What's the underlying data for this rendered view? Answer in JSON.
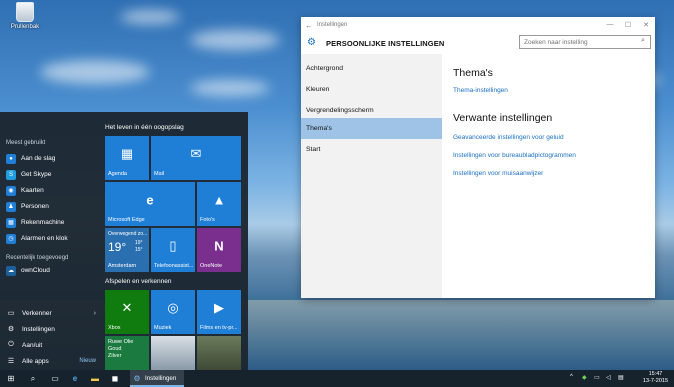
{
  "desktop": {
    "recycle_bin_label": "Prullenbak"
  },
  "start_menu": {
    "most_used_heading": "Meest gebruikt",
    "most_used": [
      {
        "label": "Aan de slag",
        "icon": "lightbulb-icon",
        "color": "#1f7ed6"
      },
      {
        "label": "Get Skype",
        "icon": "skype-icon",
        "color": "#1f9fe0"
      },
      {
        "label": "Kaarten",
        "icon": "maps-icon",
        "color": "#1f7ed6"
      },
      {
        "label": "Personen",
        "icon": "people-icon",
        "color": "#1f7ed6"
      },
      {
        "label": "Rekenmachine",
        "icon": "calculator-icon",
        "color": "#1f7ed6"
      },
      {
        "label": "Alarmen en klok",
        "icon": "alarm-clock-icon",
        "color": "#1f7ed6"
      }
    ],
    "recent_heading": "Recentelijk toegevoegd",
    "recent": [
      {
        "label": "ownCloud",
        "icon": "owncloud-icon",
        "color": "#1d5f9b"
      }
    ],
    "system": {
      "explorer": "Verkenner",
      "settings": "Instellingen",
      "power": "Aan/uit",
      "all_apps": "Alle apps",
      "new_badge": "Nieuw"
    },
    "life_heading": "Het leven in één oogopslag",
    "play_heading": "Afspelen en verkennen",
    "tiles": {
      "agenda": "Agenda",
      "mail": "Mail",
      "edge": "Microsoft Edge",
      "photos": "Foto's",
      "weather_top": "Overwegend zo...",
      "weather_temp": "19°",
      "weather_hi": "19°",
      "weather_lo": "15°",
      "weather_city": "Amsterdam",
      "phone": "Telefoonassist...",
      "onenote": "OneNote",
      "xbox": "Xbox",
      "music": "Muziek",
      "films": "Films en tv-pr...",
      "money_1": "Ruwe Olie",
      "money_2": "Goud",
      "money_3": "Zilver"
    }
  },
  "settings": {
    "window_title": "Instellingen",
    "header_title": "PERSOONLIJKE INSTELLINGEN",
    "search_placeholder": "Zoeken naar instelling",
    "nav": [
      "Achtergrond",
      "Kleuren",
      "Vergrendelingsscherm",
      "Thema's",
      "Start"
    ],
    "active_nav": "Thema's",
    "section_title": "Thema's",
    "theme_link": "Thema-instellingen",
    "related_title": "Verwante instellingen",
    "related_links": [
      "Geavanceerde instellingen voor geluid",
      "Instellingen voor bureaubladpictogrammen",
      "Instellingen voor muisaanwijzer"
    ]
  },
  "taskbar": {
    "active_app": "Instellingen",
    "time": "15:47",
    "date": "13-7-2015"
  },
  "colors": {
    "accent": "#1f7ed6",
    "link": "#1a6fc2",
    "nav_active": "#9ec3e6",
    "start_bg": "#1c2630"
  }
}
